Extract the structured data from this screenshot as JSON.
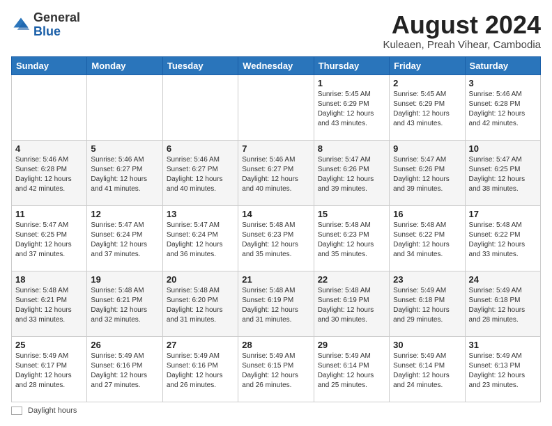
{
  "logo": {
    "general": "General",
    "blue": "Blue"
  },
  "title": "August 2024",
  "subtitle": "Kuleaen, Preah Vihear, Cambodia",
  "days_of_week": [
    "Sunday",
    "Monday",
    "Tuesday",
    "Wednesday",
    "Thursday",
    "Friday",
    "Saturday"
  ],
  "footer_label": "Daylight hours",
  "weeks": [
    [
      {
        "day": "",
        "info": ""
      },
      {
        "day": "",
        "info": ""
      },
      {
        "day": "",
        "info": ""
      },
      {
        "day": "",
        "info": ""
      },
      {
        "day": "1",
        "info": "Sunrise: 5:45 AM\nSunset: 6:29 PM\nDaylight: 12 hours\nand 43 minutes."
      },
      {
        "day": "2",
        "info": "Sunrise: 5:45 AM\nSunset: 6:29 PM\nDaylight: 12 hours\nand 43 minutes."
      },
      {
        "day": "3",
        "info": "Sunrise: 5:46 AM\nSunset: 6:28 PM\nDaylight: 12 hours\nand 42 minutes."
      }
    ],
    [
      {
        "day": "4",
        "info": "Sunrise: 5:46 AM\nSunset: 6:28 PM\nDaylight: 12 hours\nand 42 minutes."
      },
      {
        "day": "5",
        "info": "Sunrise: 5:46 AM\nSunset: 6:27 PM\nDaylight: 12 hours\nand 41 minutes."
      },
      {
        "day": "6",
        "info": "Sunrise: 5:46 AM\nSunset: 6:27 PM\nDaylight: 12 hours\nand 40 minutes."
      },
      {
        "day": "7",
        "info": "Sunrise: 5:46 AM\nSunset: 6:27 PM\nDaylight: 12 hours\nand 40 minutes."
      },
      {
        "day": "8",
        "info": "Sunrise: 5:47 AM\nSunset: 6:26 PM\nDaylight: 12 hours\nand 39 minutes."
      },
      {
        "day": "9",
        "info": "Sunrise: 5:47 AM\nSunset: 6:26 PM\nDaylight: 12 hours\nand 39 minutes."
      },
      {
        "day": "10",
        "info": "Sunrise: 5:47 AM\nSunset: 6:25 PM\nDaylight: 12 hours\nand 38 minutes."
      }
    ],
    [
      {
        "day": "11",
        "info": "Sunrise: 5:47 AM\nSunset: 6:25 PM\nDaylight: 12 hours\nand 37 minutes."
      },
      {
        "day": "12",
        "info": "Sunrise: 5:47 AM\nSunset: 6:24 PM\nDaylight: 12 hours\nand 37 minutes."
      },
      {
        "day": "13",
        "info": "Sunrise: 5:47 AM\nSunset: 6:24 PM\nDaylight: 12 hours\nand 36 minutes."
      },
      {
        "day": "14",
        "info": "Sunrise: 5:48 AM\nSunset: 6:23 PM\nDaylight: 12 hours\nand 35 minutes."
      },
      {
        "day": "15",
        "info": "Sunrise: 5:48 AM\nSunset: 6:23 PM\nDaylight: 12 hours\nand 35 minutes."
      },
      {
        "day": "16",
        "info": "Sunrise: 5:48 AM\nSunset: 6:22 PM\nDaylight: 12 hours\nand 34 minutes."
      },
      {
        "day": "17",
        "info": "Sunrise: 5:48 AM\nSunset: 6:22 PM\nDaylight: 12 hours\nand 33 minutes."
      }
    ],
    [
      {
        "day": "18",
        "info": "Sunrise: 5:48 AM\nSunset: 6:21 PM\nDaylight: 12 hours\nand 33 minutes."
      },
      {
        "day": "19",
        "info": "Sunrise: 5:48 AM\nSunset: 6:21 PM\nDaylight: 12 hours\nand 32 minutes."
      },
      {
        "day": "20",
        "info": "Sunrise: 5:48 AM\nSunset: 6:20 PM\nDaylight: 12 hours\nand 31 minutes."
      },
      {
        "day": "21",
        "info": "Sunrise: 5:48 AM\nSunset: 6:19 PM\nDaylight: 12 hours\nand 31 minutes."
      },
      {
        "day": "22",
        "info": "Sunrise: 5:48 AM\nSunset: 6:19 PM\nDaylight: 12 hours\nand 30 minutes."
      },
      {
        "day": "23",
        "info": "Sunrise: 5:49 AM\nSunset: 6:18 PM\nDaylight: 12 hours\nand 29 minutes."
      },
      {
        "day": "24",
        "info": "Sunrise: 5:49 AM\nSunset: 6:18 PM\nDaylight: 12 hours\nand 28 minutes."
      }
    ],
    [
      {
        "day": "25",
        "info": "Sunrise: 5:49 AM\nSunset: 6:17 PM\nDaylight: 12 hours\nand 28 minutes."
      },
      {
        "day": "26",
        "info": "Sunrise: 5:49 AM\nSunset: 6:16 PM\nDaylight: 12 hours\nand 27 minutes."
      },
      {
        "day": "27",
        "info": "Sunrise: 5:49 AM\nSunset: 6:16 PM\nDaylight: 12 hours\nand 26 minutes."
      },
      {
        "day": "28",
        "info": "Sunrise: 5:49 AM\nSunset: 6:15 PM\nDaylight: 12 hours\nand 26 minutes."
      },
      {
        "day": "29",
        "info": "Sunrise: 5:49 AM\nSunset: 6:14 PM\nDaylight: 12 hours\nand 25 minutes."
      },
      {
        "day": "30",
        "info": "Sunrise: 5:49 AM\nSunset: 6:14 PM\nDaylight: 12 hours\nand 24 minutes."
      },
      {
        "day": "31",
        "info": "Sunrise: 5:49 AM\nSunset: 6:13 PM\nDaylight: 12 hours\nand 23 minutes."
      }
    ]
  ]
}
